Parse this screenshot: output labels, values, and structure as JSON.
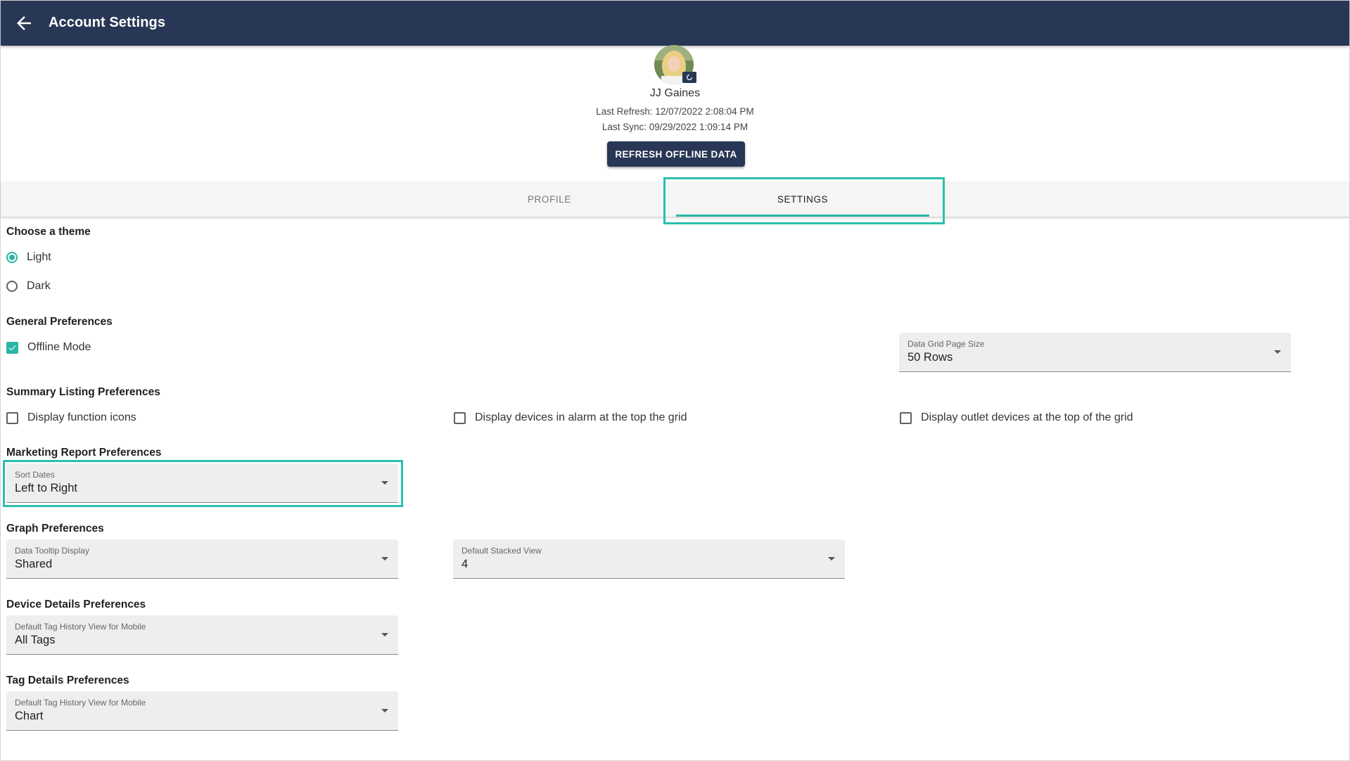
{
  "header": {
    "title": "Account Settings",
    "back_icon": "arrow-left-icon"
  },
  "profile": {
    "name": "JJ Gaines",
    "last_refresh": "Last Refresh: 12/07/2022 2:08:04 PM",
    "last_sync": "Last Sync: 09/29/2022 1:09:14 PM",
    "refresh_button": "REFRESH OFFLINE DATA"
  },
  "tabs": {
    "profile": "PROFILE",
    "settings": "SETTINGS",
    "active": "settings"
  },
  "theme": {
    "heading": "Choose a theme",
    "options": [
      "Light",
      "Dark"
    ],
    "selected": "Light"
  },
  "general": {
    "heading": "General Preferences",
    "offline_mode": {
      "label": "Offline Mode",
      "checked": true
    },
    "page_size": {
      "label": "Data Grid Page Size",
      "value": "50 Rows"
    }
  },
  "summary": {
    "heading": "Summary Listing Preferences",
    "checkboxes": [
      {
        "label": "Display function icons",
        "checked": false
      },
      {
        "label": "Display devices in alarm at the top the grid",
        "checked": false
      },
      {
        "label": "Display outlet devices at the top of the grid",
        "checked": false
      }
    ]
  },
  "marketing": {
    "heading": "Marketing Report Preferences",
    "sort_dates": {
      "label": "Sort Dates",
      "value": "Left to Right"
    }
  },
  "graph": {
    "heading": "Graph Preferences",
    "tooltip": {
      "label": "Data Tooltip Display",
      "value": "Shared"
    },
    "stacked": {
      "label": "Default Stacked View",
      "value": "4"
    }
  },
  "device": {
    "heading": "Device Details Preferences",
    "history": {
      "label": "Default Tag History View for Mobile",
      "value": "All Tags"
    }
  },
  "tag": {
    "heading": "Tag Details Preferences",
    "history": {
      "label": "Default Tag History View for Mobile",
      "value": "Chart"
    }
  },
  "colors": {
    "primary": "#283755",
    "accent": "#2bb6a8",
    "highlight": "#2bbfae"
  }
}
